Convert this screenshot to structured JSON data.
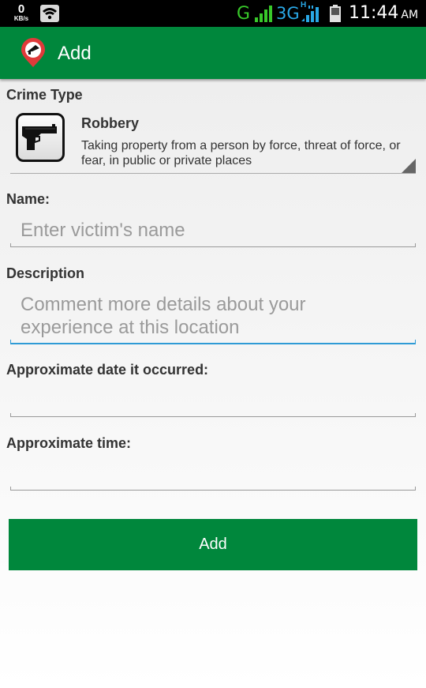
{
  "status_bar": {
    "data_rate": "0",
    "data_unit": "KB/s",
    "network_g": "G",
    "network_3g": "3G",
    "network_h": "H",
    "time": "11:44",
    "ampm": "AM",
    "icons": [
      "wifi-icon",
      "signal-icon",
      "battery-icon"
    ]
  },
  "action_bar": {
    "title": "Add",
    "logo_icon": "location-pin-logo",
    "color": "#00873c"
  },
  "form": {
    "crime_type_label": "Crime Type",
    "crime_type": {
      "icon": "handgun-icon",
      "name": "Robbery",
      "description": "Taking property from a person by force, threat of force, or fear, in public or private places"
    },
    "name_label": "Name:",
    "name_placeholder": "Enter victim's name",
    "description_label": "Description",
    "description_placeholder": "Comment more details about your experience at this location",
    "date_label": "Approximate date it occurred:",
    "date_value": "",
    "time_label": "Approximate time:",
    "time_value": ""
  },
  "add_button": {
    "label": "Add",
    "color": "#00873c"
  },
  "accent_focus_color": "#2f9bd6"
}
